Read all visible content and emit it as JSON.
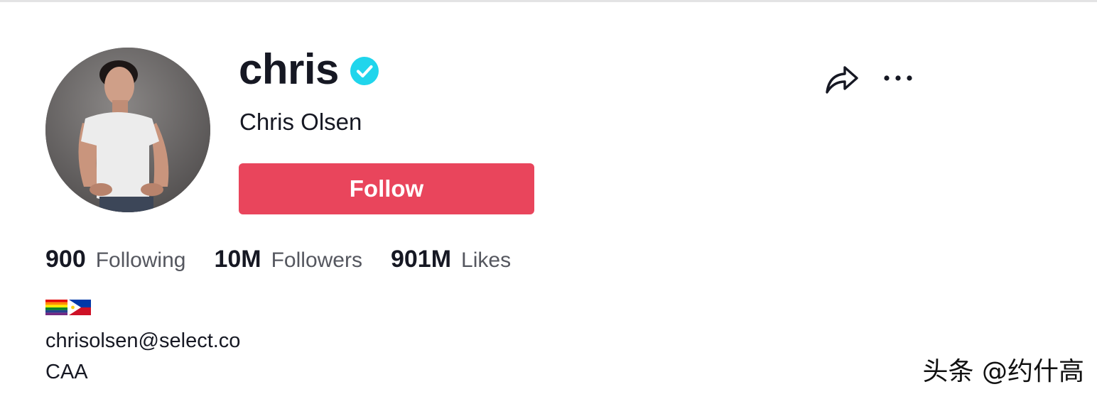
{
  "profile": {
    "username": "chris",
    "display_name": "Chris Olsen",
    "verified": true,
    "verified_color": "#20d5ec",
    "avatar_icon": "profile-photo"
  },
  "actions": {
    "follow_label": "Follow",
    "follow_color": "#e9455c",
    "share_icon": "share-arrow-icon",
    "more_icon": "more-dots-icon"
  },
  "stats": [
    {
      "value": "900",
      "label": "Following"
    },
    {
      "value": "10M",
      "label": "Followers"
    },
    {
      "value": "901M",
      "label": "Likes"
    }
  ],
  "bio": {
    "flags": [
      "rainbow-pride-flag",
      "philippines-flag"
    ],
    "email": "chrisolsen@select.co",
    "agency": "CAA"
  },
  "watermark": "头条 @约什高"
}
